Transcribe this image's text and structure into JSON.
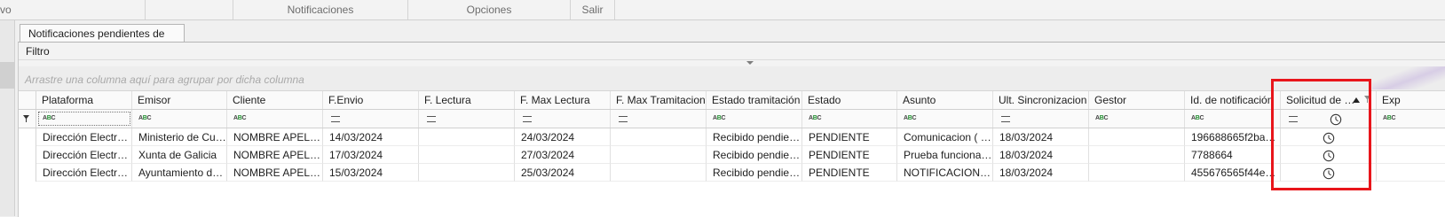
{
  "ribbon": {
    "groups": [
      "vo",
      "",
      "Notificaciones",
      "Opciones",
      "Salir"
    ]
  },
  "tab": {
    "label": "Notificaciones pendientes de lectura"
  },
  "filter_label": "Filtro",
  "group_panel_hint": "Arrastre una columna aquí para agrupar por dicha columna",
  "columns": [
    "Plataforma",
    "Emisor",
    "Cliente",
    "F.Envio",
    "F. Lectura",
    "F. Max Lectura",
    "F. Max Tramitacion",
    "Estado tramitación",
    "Estado",
    "Asunto",
    "Ult. Sincronizacion",
    "Gestor",
    "Id. de notificación",
    "Solicitud de des...",
    "Exp"
  ],
  "sorted_column": {
    "index": 13,
    "direction": "ascending"
  },
  "filter_row": {
    "text_filter_icon": "abc-filter-icon",
    "equals_filter_icon": "equals-filter-icon"
  },
  "rows": [
    [
      "Dirección Electrónic...",
      "Ministerio de Cultura ...",
      "NOMBRE APELLID...",
      "14/03/2024",
      "",
      "24/03/2024",
      "",
      "Recibido pendiente ...",
      "PENDIENTE",
      "Comunicacion ( DO...",
      "18/03/2024",
      "",
      "196688665f2ba35c...",
      "",
      ""
    ],
    [
      "Dirección Electrónic...",
      "Xunta de Galicia",
      "NOMBRE APELLID...",
      "17/03/2024",
      "",
      "27/03/2024",
      "",
      "Recibido pendiente ...",
      "PENDIENTE",
      "Prueba funcionamie...",
      "18/03/2024",
      "",
      "7788664",
      "",
      ""
    ],
    [
      "Dirección Electrónic...",
      "Ayuntamiento de Sot...",
      "NOMBRE APELLID...",
      "15/03/2024",
      "",
      "25/03/2024",
      "",
      "Recibido pendiente ...",
      "PENDIENTE",
      "NOTIFICACION DE ...",
      "18/03/2024",
      "",
      "455676565f44e6a4...",
      "",
      ""
    ]
  ],
  "colors": {
    "highlight": "#e8151b",
    "abc_green": "#1e8c2d"
  }
}
